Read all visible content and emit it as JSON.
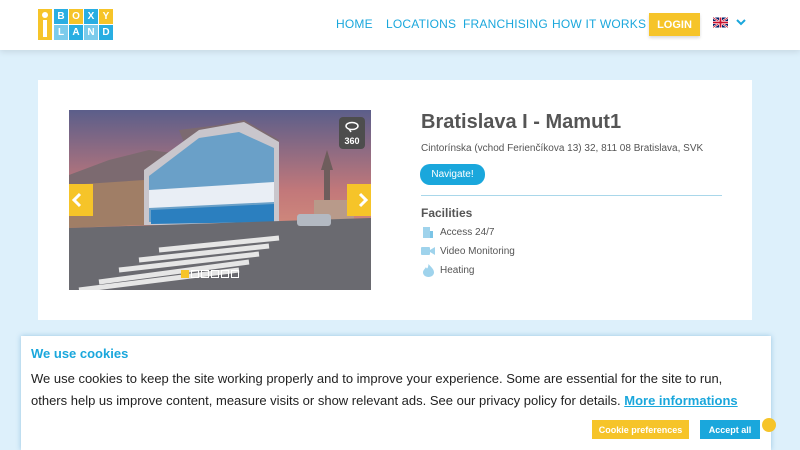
{
  "header": {
    "logo_letters": [
      "B",
      "O",
      "X",
      "Y",
      "L",
      "A",
      "N",
      "D"
    ],
    "nav": [
      "HOME",
      "LOCATIONS",
      "FRANCHISING",
      "HOW IT WORKS"
    ],
    "login_label": "LOGIN",
    "language_icon": "uk-flag-icon"
  },
  "location": {
    "title": "Bratislava I - Mamut1",
    "address": "Cintorínska (vchod Ferienčíkova 13) 32, 811 08 Bratislava, SVK",
    "navigate_label": "Navigate!",
    "badge_360": "360",
    "gallery": {
      "slide_count": 6,
      "active_slide": 1
    },
    "facilities_heading": "Facilities",
    "facilities": [
      {
        "label": "Access 24/7",
        "icon": "door-access-icon"
      },
      {
        "label": "Video Monitoring",
        "icon": "video-camera-icon"
      },
      {
        "label": "Heating",
        "icon": "flame-icon"
      }
    ]
  },
  "cookie": {
    "title": "We use cookies",
    "text": "We use cookies to keep the site working properly and to improve your experience. Some are essential for the site to run, others help us improve content, measure visits or show relevant ads. See our privacy policy for details.",
    "link": "More informations",
    "preferences_label": "Cookie preferences",
    "accept_label": "Accept all"
  },
  "colors": {
    "brand_blue": "#1aa7dc",
    "brand_yellow": "#f6c429",
    "page_bg": "#ddf0fb"
  }
}
